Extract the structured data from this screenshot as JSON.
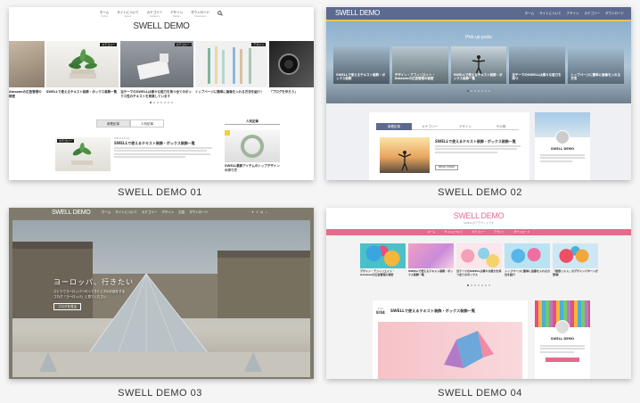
{
  "demos": [
    {
      "caption": "SWELL DEMO 01",
      "logo": "SWELL DEMO",
      "nav": [
        {
          "label": "ホーム",
          "sub": "Home"
        },
        {
          "label": "サイトについて",
          "sub": "About"
        },
        {
          "label": "カテゴリー",
          "sub": "Category"
        },
        {
          "label": "デザイン",
          "sub": "Design"
        },
        {
          "label": "ダウンロード",
          "sub": "Download"
        }
      ],
      "slides": [
        {
          "title": "Amazonの広告管理の秘密",
          "tag": ""
        },
        {
          "title": "SWELLで使えるテキスト装飾・ボックス装飾一覧",
          "tag": "カテゴリー"
        },
        {
          "title": "当テーマのSWELLは様々な能力を持つ全てのボックス性のテキストを用意しています",
          "tag": "カテゴリー"
        },
        {
          "title": "トップページに簡単に画像を入れる方法を紹介！",
          "tag": "デザイン"
        },
        {
          "title": "「ブログを作ろう」",
          "tag": ""
        }
      ],
      "tabs": [
        "新着記事",
        "人気記事"
      ],
      "post": {
        "date": "2019.02.04",
        "title": "SWELLで使えるテキスト装飾・ボックス装飾一覧",
        "tag": "カテゴリー"
      },
      "sidebar_title": "人気記事",
      "sidebar_post": "SWELL最新アイテムのトップデザインの作り方"
    },
    {
      "caption": "SWELL DEMO 02",
      "logo": "SWELL DEMO",
      "nav": [
        {
          "label": "ホーム",
          "sub": ""
        },
        {
          "label": "サイトについて",
          "sub": ""
        },
        {
          "label": "デザイン",
          "sub": ""
        },
        {
          "label": "カテゴリー",
          "sub": ""
        },
        {
          "label": "ダウンロード",
          "sub": ""
        }
      ],
      "pickup_title": "Pick up posts",
      "slides": [
        {
          "title": "SWELLで使えるテキスト装飾・ボックス装飾"
        },
        {
          "title": "デザイン・アフィリエイト・Amazonの広告管理の秘密"
        },
        {
          "title": "SWELLで使えるテキスト装飾・ボックス装飾一覧"
        },
        {
          "title": "当テーマのSWELLは様々な能力を持つ"
        },
        {
          "title": "トップページに簡単に画像を入れる方法"
        }
      ],
      "tabs": [
        "新着記事",
        "カテゴリー",
        "デザイン",
        "その他"
      ],
      "post": {
        "title": "SWELLで使えるテキスト装飾・ボックス装飾一覧",
        "more": "READ MORE"
      },
      "profile_name": "SWELL DEMO"
    },
    {
      "caption": "SWELL DEMO 03",
      "logo": "SWELL DEMO",
      "nav": [
        {
          "label": "ホーム",
          "sub": ""
        },
        {
          "label": "サイトについて",
          "sub": ""
        },
        {
          "label": "カテゴリー",
          "sub": ""
        },
        {
          "label": "デザイン",
          "sub": ""
        },
        {
          "label": "広告",
          "sub": ""
        },
        {
          "label": "ダウンロード",
          "sub": ""
        }
      ],
      "hero_title": "ヨーロッパ、行きたい",
      "hero_lines": [
        "ひとりでヨーロッパへ行ってきたときのお話をする",
        "ブログ「ヨーロッパ」と見てください"
      ],
      "hero_button": "ブログを見る"
    },
    {
      "caption": "SWELL DEMO 04",
      "logo": "SWELL DEMO",
      "tagline": "SWELLのデモサイトです",
      "nav": [
        {
          "label": "ホーム",
          "sub": ""
        },
        {
          "label": "サイトについて",
          "sub": ""
        },
        {
          "label": "カテゴリー",
          "sub": ""
        },
        {
          "label": "デザイン",
          "sub": ""
        },
        {
          "label": "ダウンロード",
          "sub": ""
        }
      ],
      "slides": [
        {
          "title": "デザイン・アフィリエイト・Amazonの広告管理の秘密"
        },
        {
          "title": "SWELLで使えるテキスト装飾・ボックス装飾一覧"
        },
        {
          "title": "当テーマのSWELLは様々な能力を持つ全てのボックス"
        },
        {
          "title": "トップページに簡単に画像を入れる方法を紹介"
        },
        {
          "title": "「無限リスト」のデザインパターンが登場！"
        }
      ],
      "post": {
        "date_year": "2019",
        "date_day": "8/04",
        "title": "SWELLで使えるテキスト装飾・ボックス装飾一覧"
      },
      "profile_name": "SWELL DEMO"
    }
  ],
  "colors": {
    "demo02_header": "#5d6a8f",
    "demo02_accent": "#f3c14a",
    "demo03_header": "#7e7b6c",
    "demo04_pink": "#e46b8d"
  }
}
